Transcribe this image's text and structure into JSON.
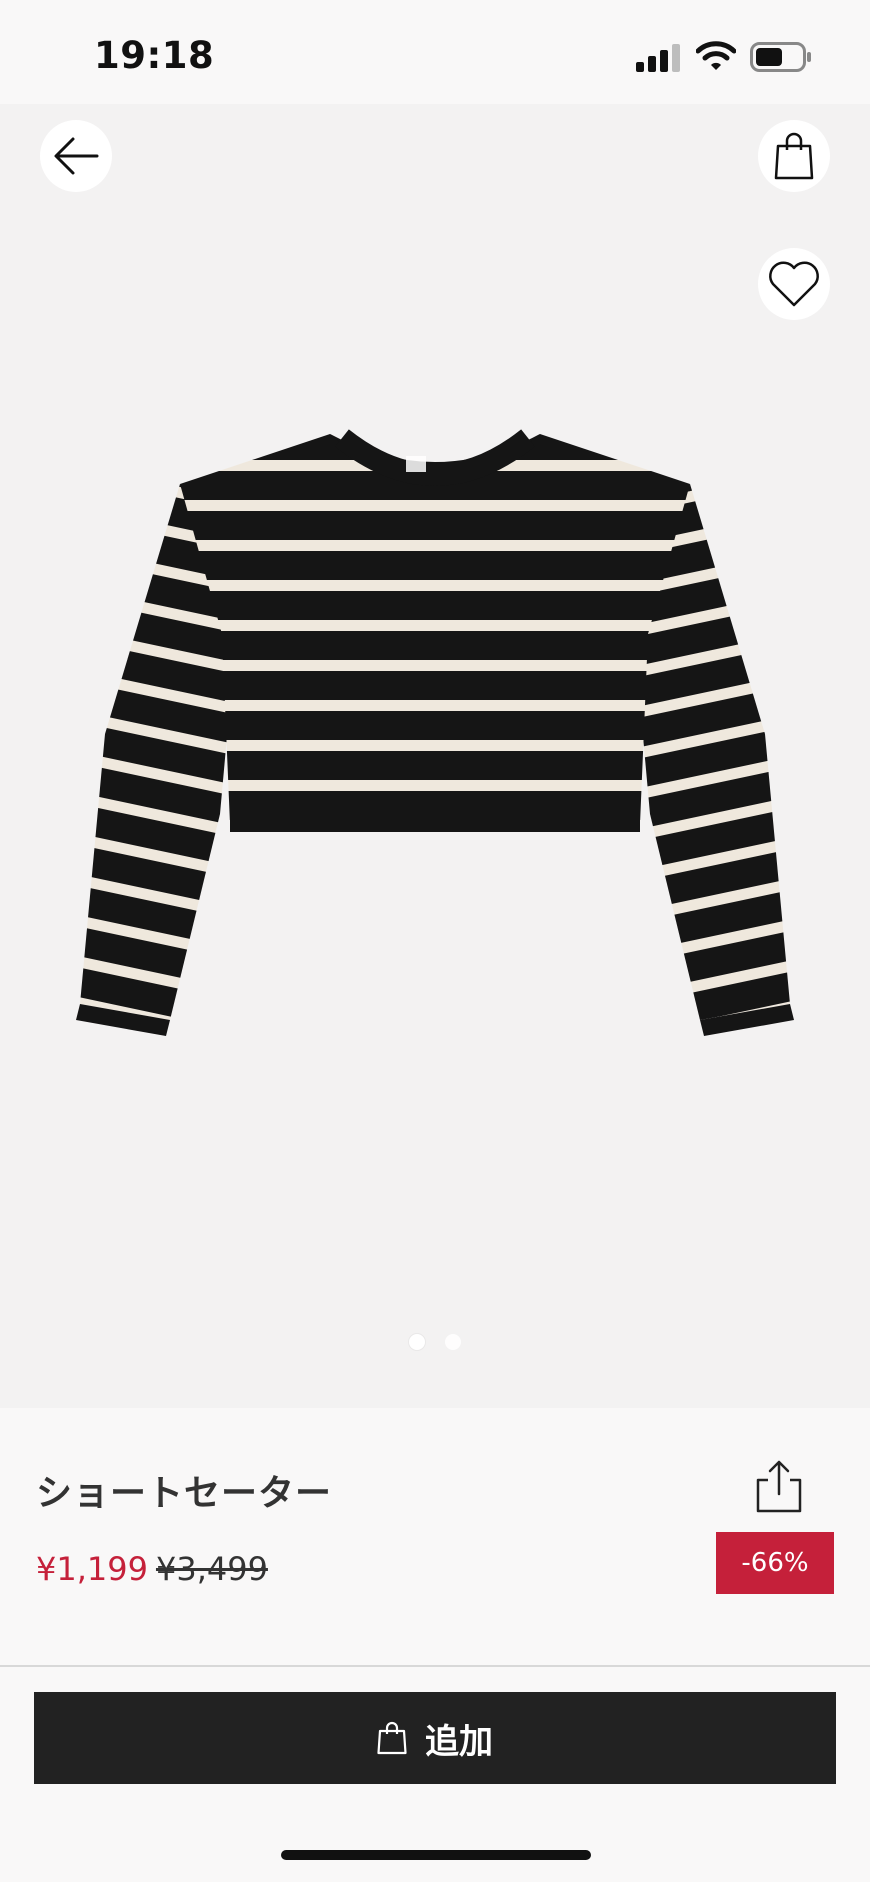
{
  "status_bar": {
    "time": "19:18"
  },
  "gallery": {
    "image_count": 2,
    "active_index": 0
  },
  "product": {
    "name": "ショートセーター",
    "sale_price": "¥1,199",
    "original_price": "¥3,499",
    "discount": "-66%"
  },
  "add_button": {
    "label": "追加"
  },
  "colors": {
    "accent_red": "#c5203a",
    "button_dark": "#222222",
    "image_bg": "#f3f2f2",
    "page_bg": "#f9f8f8"
  },
  "icons": [
    "back-arrow-icon",
    "shopping-bag-icon",
    "heart-icon",
    "share-icon",
    "cellular-signal-icon",
    "wifi-icon",
    "battery-icon"
  ]
}
